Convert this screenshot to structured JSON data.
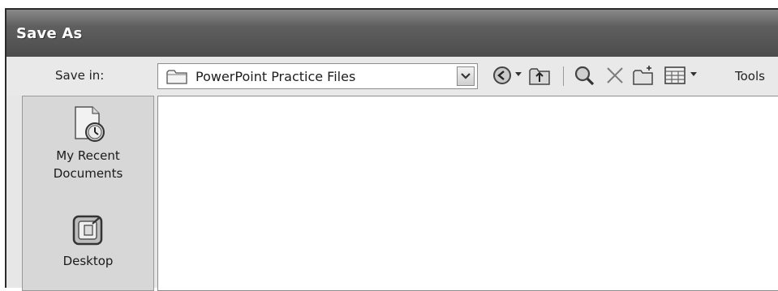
{
  "dialog": {
    "title": "Save As"
  },
  "toolbar": {
    "save_in_label": "Save in:",
    "location": "PowerPoint Practice Files",
    "tools_label": "Tools",
    "icons": [
      "back-icon",
      "dropdown-arrow-icon",
      "up-folder-icon",
      "search-web-icon",
      "delete-icon",
      "new-folder-icon",
      "views-icon",
      "dropdown-arrow-icon"
    ]
  },
  "places_bar": {
    "items": [
      {
        "label_line1": "My Recent",
        "label_line2": "Documents",
        "icon": "recent-documents-icon"
      },
      {
        "label_line1": "Desktop",
        "label_line2": "",
        "icon": "desktop-icon"
      }
    ]
  }
}
